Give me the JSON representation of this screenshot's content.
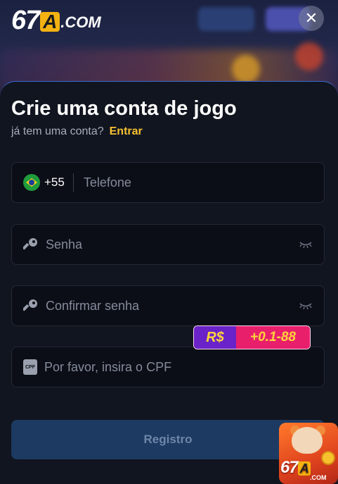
{
  "brand": {
    "logo_num": "67",
    "logo_letter": "A",
    "logo_suffix": ".COM"
  },
  "header": {
    "close_symbol": "✕"
  },
  "form": {
    "title": "Crie uma conta de jogo",
    "subtitle": "já tem uma conta?",
    "login_link": "Entrar",
    "phone": {
      "country_code": "+55",
      "placeholder": "Telefone",
      "flag_icon": "brazil-flag-icon"
    },
    "password": {
      "placeholder": "Senha",
      "icon": "key-icon",
      "toggle_icon": "eye-closed-icon"
    },
    "confirm_password": {
      "placeholder": "Confirmar senha",
      "icon": "key-icon",
      "toggle_icon": "eye-closed-icon"
    },
    "cpf": {
      "placeholder": "Por favor, insira o CPF",
      "icon": "cpf-card-icon",
      "icon_text": "CPF"
    },
    "submit_label": "Registro"
  },
  "promo": {
    "currency": "R$",
    "amount": "+0.1-88"
  },
  "mascot": {
    "logo_num": "67",
    "logo_letter": "A",
    "logo_suffix": ".COM"
  },
  "colors": {
    "accent_yellow": "#f5c032",
    "button_bg": "#1c3a62",
    "sheet_border": "#3a6bd4"
  }
}
